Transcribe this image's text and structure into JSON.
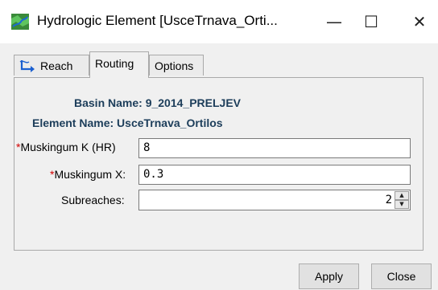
{
  "window": {
    "title": "Hydrologic Element [UsceTrnava_Orti...",
    "minimize_glyph": "—",
    "maximize_glyph": "☐",
    "close_glyph": "✕",
    "app_icon": "basin-map-icon"
  },
  "tabs": [
    {
      "label": "Reach",
      "icon": "reach-icon",
      "active": false
    },
    {
      "label": "Routing",
      "active": true
    },
    {
      "label": "Options",
      "active": false
    }
  ],
  "routing": {
    "basin_name_label": "Basin Name:",
    "basin_name_value": "9_2014_PRELJEV",
    "element_name_label": "Element Name:",
    "element_name_value": "UsceTrnava_Ortilos",
    "required_marker": "*",
    "muskingum_k_label": "Muskingum K (HR)",
    "muskingum_k_value": "8",
    "muskingum_x_label": "Muskingum X:",
    "muskingum_x_value": "0.3",
    "subreaches_label": "Subreaches:",
    "subreaches_value": "2",
    "spin_up": "▲",
    "spin_down": "▼"
  },
  "buttons": {
    "apply": "Apply",
    "close": "Close"
  },
  "colors": {
    "required": "#d00000",
    "info_label": "#1c3d5a"
  }
}
